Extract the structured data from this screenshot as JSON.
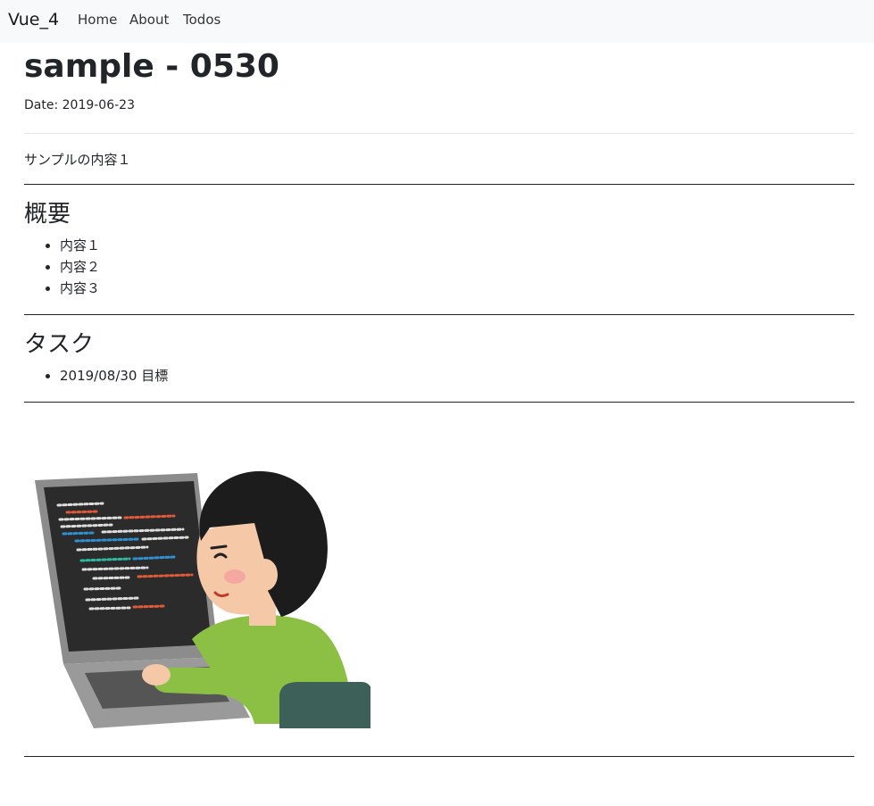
{
  "navbar": {
    "brand": "Vue_4",
    "links": [
      "Home",
      "About",
      "Todos"
    ]
  },
  "post": {
    "title": "sample - 0530",
    "date": "Date: 2019-06-23",
    "summary": "サンプルの内容１",
    "sections": [
      {
        "heading": "概要",
        "items": [
          "内容１",
          "内容２",
          "内容３"
        ]
      },
      {
        "heading": "タスク",
        "items": [
          "2019/08/30 目標"
        ]
      }
    ]
  },
  "illustration": {
    "icon": "programmer-at-laptop-illustration"
  },
  "colors": {
    "navbar_bg": "#f8f9fa",
    "text": "#212529",
    "shirt": "#8cc045",
    "chair": "#3d6158",
    "laptop": "#8c8c8c"
  }
}
